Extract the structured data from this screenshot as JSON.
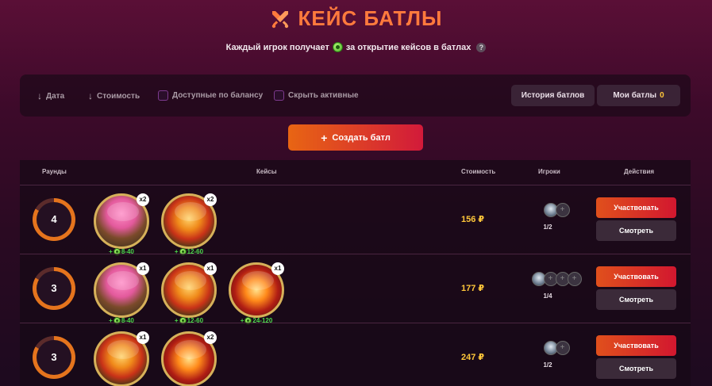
{
  "header": {
    "title": "КЕЙС БАТЛЫ",
    "subtitle_pre": "Каждый игрок получает",
    "subtitle_post": "за открытие кейсов в батлах",
    "help": "?"
  },
  "filters": {
    "date": "Дата",
    "cost": "Стоимость",
    "available": "Доступные по балансу",
    "hide_active": "Скрыть активные",
    "history": "История батлов",
    "my_battles": "Мои батлы",
    "my_count": "0"
  },
  "create_button": "Создать батл",
  "table": {
    "headers": [
      "Раунды",
      "Кейсы",
      "Стоимость",
      "Игроки",
      "Действия"
    ],
    "rows": [
      {
        "rounds": "4",
        "cases": [
          {
            "kind": "tree",
            "mult": "x2",
            "reward": "8-40"
          },
          {
            "kind": "lantern",
            "mult": "x2",
            "reward": "12-60"
          }
        ],
        "price": "156 ₽",
        "players": "1/2",
        "join": "Участвовать",
        "watch": "Смотреть"
      },
      {
        "rounds": "3",
        "cases": [
          {
            "kind": "tree",
            "mult": "x1",
            "reward": "8-40"
          },
          {
            "kind": "lantern",
            "mult": "x1",
            "reward": "12-60"
          },
          {
            "kind": "fire",
            "mult": "x1",
            "reward": "24-120"
          }
        ],
        "price": "177 ₽",
        "players": "1/4",
        "join": "Участвовать",
        "watch": "Смотреть"
      },
      {
        "rounds": "3",
        "cases": [
          {
            "kind": "lantern",
            "mult": "x1",
            "reward": "12-60"
          },
          {
            "kind": "fire",
            "mult": "x2",
            "reward": "24-120"
          }
        ],
        "price": "247 ₽",
        "players": "1/2",
        "join": "Участвовать",
        "watch": "Смотреть"
      }
    ]
  },
  "colors": {
    "accent": "#ff7a3d",
    "price": "#ffc73a",
    "reward": "#4bd84b"
  }
}
